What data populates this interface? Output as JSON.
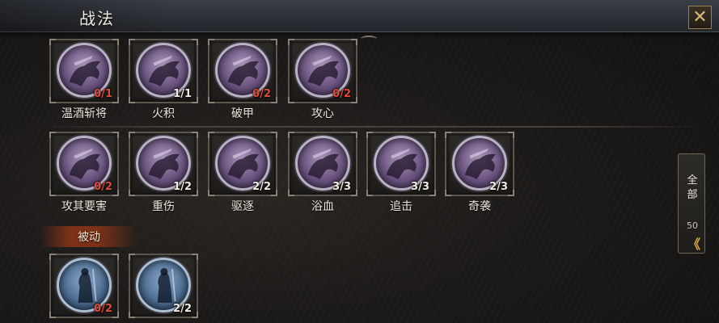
{
  "header": {
    "title": "战法",
    "close_icon": "close-icon"
  },
  "sections": {
    "active_rows": [
      [
        {
          "name": "温酒斩将",
          "count": "0/1",
          "color": "purple",
          "icon": "rider-icon"
        },
        {
          "name": "火积",
          "count": "1/1",
          "color": "purple",
          "icon": "rider-icon"
        },
        {
          "name": "破甲",
          "count": "0/2",
          "color": "purple",
          "icon": "rider-icon"
        },
        {
          "name": "攻心",
          "count": "0/2",
          "color": "purple",
          "icon": "rider-icon"
        }
      ],
      [
        {
          "name": "攻其要害",
          "count": "0/2",
          "color": "purple",
          "icon": "rider-icon"
        },
        {
          "name": "重伤",
          "count": "1/2",
          "color": "purple",
          "icon": "rider-icon"
        },
        {
          "name": "驱逐",
          "count": "2/2",
          "color": "purple",
          "icon": "rider-icon"
        },
        {
          "name": "浴血",
          "count": "3/3",
          "color": "purple",
          "icon": "rider-icon"
        },
        {
          "name": "追击",
          "count": "3/3",
          "color": "purple",
          "icon": "rider-icon"
        },
        {
          "name": "奇袭",
          "count": "2/3",
          "color": "purple",
          "icon": "rider-icon"
        }
      ]
    ],
    "passive_label": "被动",
    "passive_row": [
      {
        "name": "",
        "count": "0/2",
        "color": "blue",
        "icon": "warrior-icon"
      },
      {
        "name": "",
        "count": "2/2",
        "color": "blue",
        "icon": "warrior-icon"
      }
    ]
  },
  "side_tab": {
    "label": "全部",
    "count": "50",
    "arrow": "《",
    "arrow_icon": "double-chevron-left-icon"
  },
  "colors": {
    "zero_count": "#e04a3a",
    "normal_count": "#f0ece2",
    "accent": "#d9a84a"
  }
}
